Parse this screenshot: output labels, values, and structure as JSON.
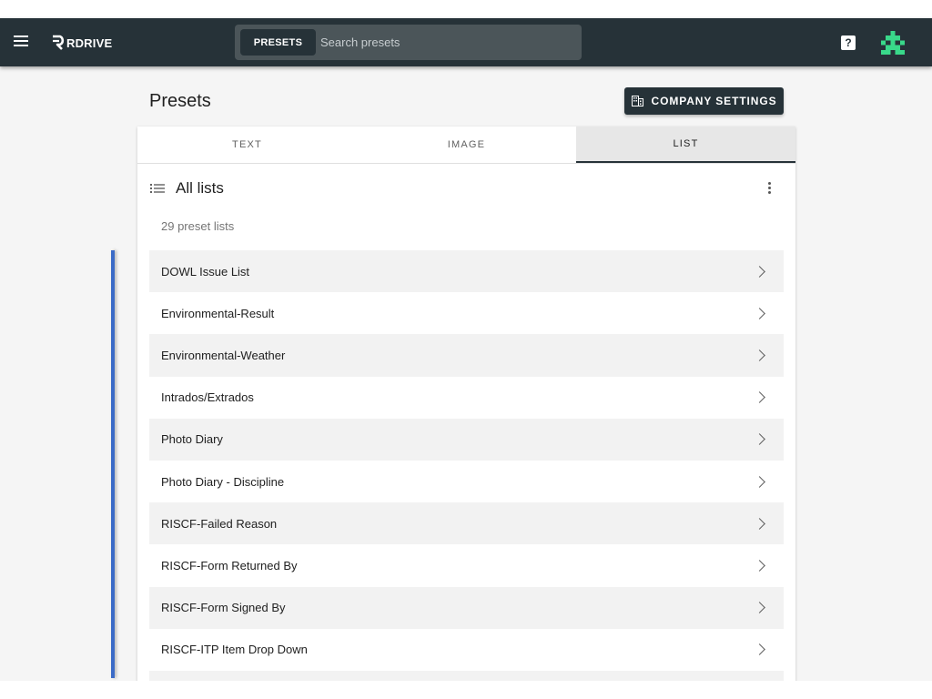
{
  "header": {
    "brand": "RDRIVE",
    "search_chip": "PRESETS",
    "search_placeholder": "Search presets",
    "help_glyph": "?"
  },
  "page": {
    "title": "Presets",
    "company_settings_label": "COMPANY SETTINGS"
  },
  "tabs": [
    {
      "label": "TEXT",
      "active": false
    },
    {
      "label": "IMAGE",
      "active": false
    },
    {
      "label": "LIST",
      "active": true
    }
  ],
  "list": {
    "title": "All lists",
    "count_text": "29 preset lists",
    "items": [
      "DOWL Issue List",
      "Environmental-Result",
      "Environmental-Weather",
      "Intrados/Extrados",
      "Photo Diary",
      "Photo Diary - Discipline",
      "RISCF-Failed Reason",
      "RISCF-Form Returned By",
      "RISCF-Form Signed By",
      "RISCF-ITP Item Drop Down",
      ""
    ]
  },
  "colors": {
    "appbar": "#263238",
    "accent": "#3b6bc7",
    "avatar": "#39d98a"
  }
}
